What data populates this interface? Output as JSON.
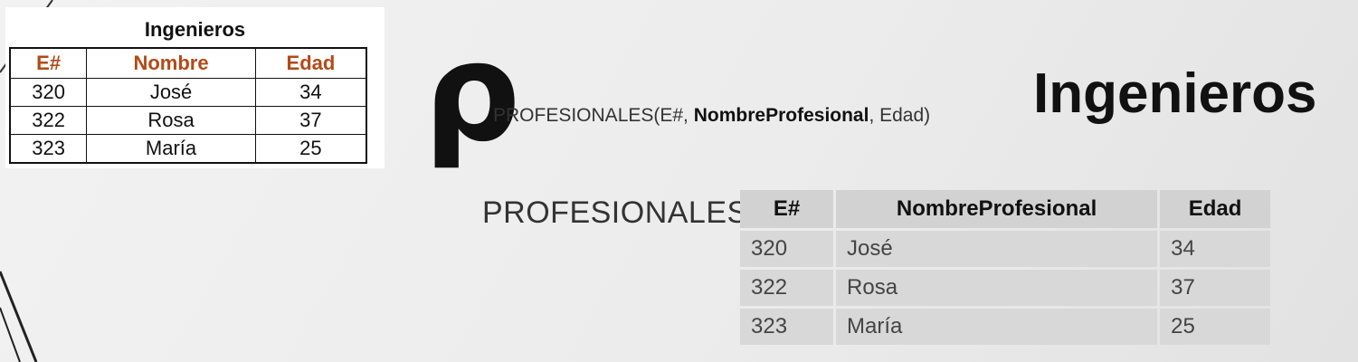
{
  "source_table": {
    "title": "Ingenieros",
    "headers": [
      "E#",
      "Nombre",
      "Edad"
    ],
    "rows": [
      [
        "320",
        "José",
        "34"
      ],
      [
        "322",
        "Rosa",
        "37"
      ],
      [
        "323",
        "María",
        "25"
      ]
    ],
    "header_color": "#b24a17"
  },
  "expression": {
    "operator_symbol": "ρ",
    "subscript_prefix": "PROFESIONALES(E#, ",
    "subscript_bold": "NombreProfesional",
    "subscript_suffix": ", Edad)",
    "relation": "Ingenieros"
  },
  "result_table": {
    "label": "PROFESIONALES",
    "headers": [
      "E#",
      "NombreProfesional",
      "Edad"
    ],
    "rows": [
      [
        "320",
        "José",
        "34"
      ],
      [
        "322",
        "Rosa",
        "37"
      ],
      [
        "323",
        "María",
        "25"
      ]
    ]
  }
}
